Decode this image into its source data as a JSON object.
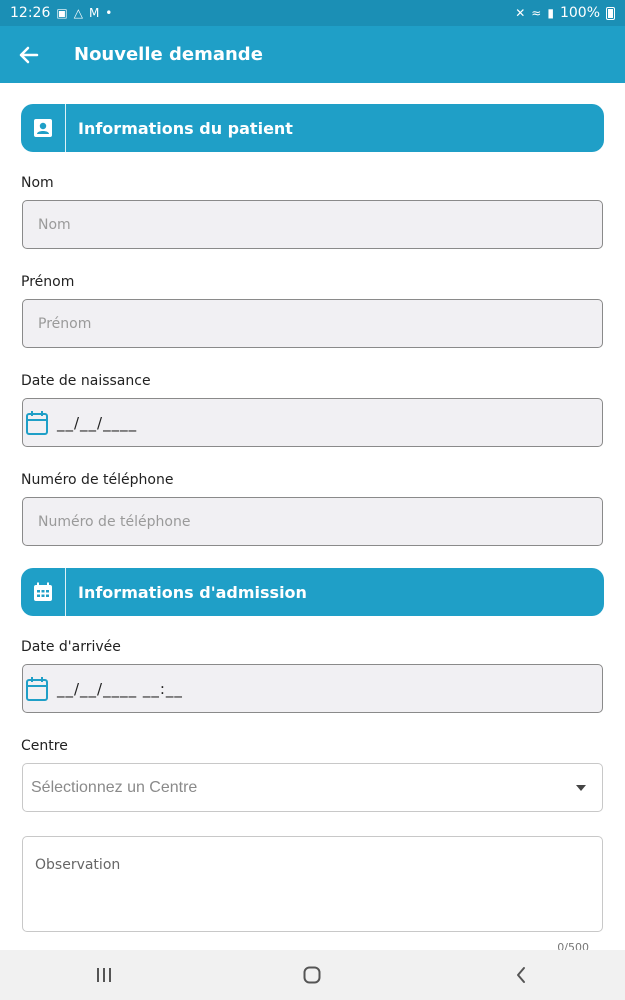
{
  "statusbar": {
    "time": "12:26",
    "battery": "100%"
  },
  "appbar": {
    "title": "Nouvelle demande"
  },
  "sections": {
    "patient": {
      "title": "Informations du patient"
    },
    "admission": {
      "title": "Informations d'admission"
    }
  },
  "form": {
    "nom": {
      "label": "Nom",
      "placeholder": "Nom"
    },
    "prenom": {
      "label": "Prénom",
      "placeholder": "Prénom"
    },
    "naissance": {
      "label": "Date de naissance",
      "mask": "__/__/____"
    },
    "telephone": {
      "label": "Numéro de téléphone",
      "placeholder": "Numéro de téléphone"
    },
    "arrivee": {
      "label": "Date d'arrivée",
      "mask": "__/__/____ __:__"
    },
    "centre": {
      "label": "Centre",
      "placeholder": "Sélectionnez un Centre"
    },
    "observation": {
      "placeholder": "Observation",
      "counter": "0/500"
    }
  },
  "colors": {
    "primary": "#1f9fc7",
    "status": "#1b8fb5"
  }
}
